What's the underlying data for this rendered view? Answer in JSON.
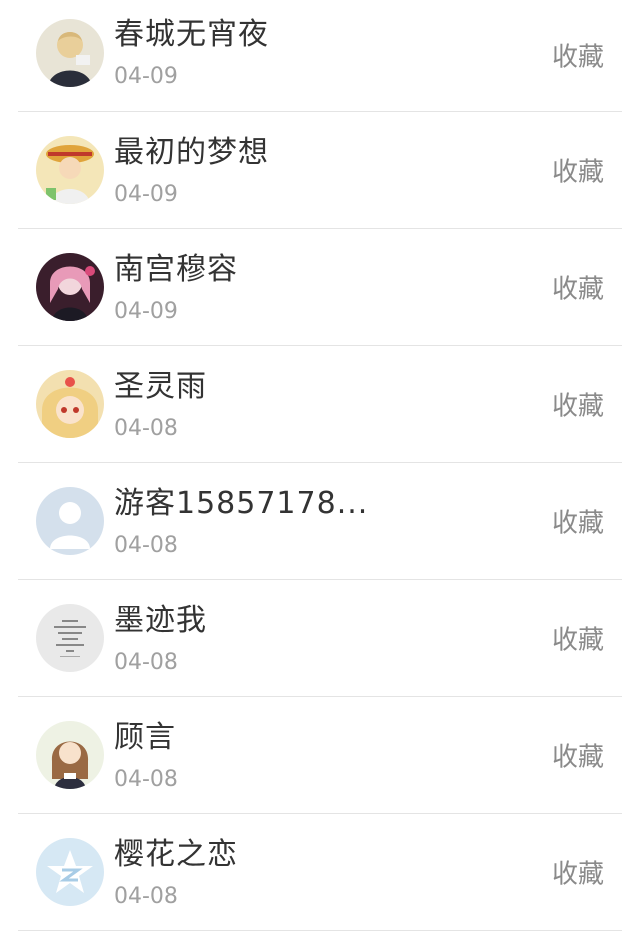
{
  "list": {
    "action_label": "收藏",
    "items": [
      {
        "name": "春城无宵夜",
        "date": "04-09",
        "avatar": "anime-avatar-icon"
      },
      {
        "name": "最初的梦想",
        "date": "04-09",
        "avatar": "anime-avatar-icon"
      },
      {
        "name": "南宫穆容",
        "date": "04-09",
        "avatar": "anime-avatar-icon"
      },
      {
        "name": "圣灵雨",
        "date": "04-08",
        "avatar": "anime-avatar-icon"
      },
      {
        "name": "游客15857178...",
        "date": "04-08",
        "avatar": "default-user-avatar-icon"
      },
      {
        "name": "墨迹我",
        "date": "04-08",
        "avatar": "text-avatar-icon"
      },
      {
        "name": "顾言",
        "date": "04-08",
        "avatar": "anime-avatar-icon"
      },
      {
        "name": "樱花之恋",
        "date": "04-08",
        "avatar": "qzone-avatar-icon"
      }
    ]
  }
}
